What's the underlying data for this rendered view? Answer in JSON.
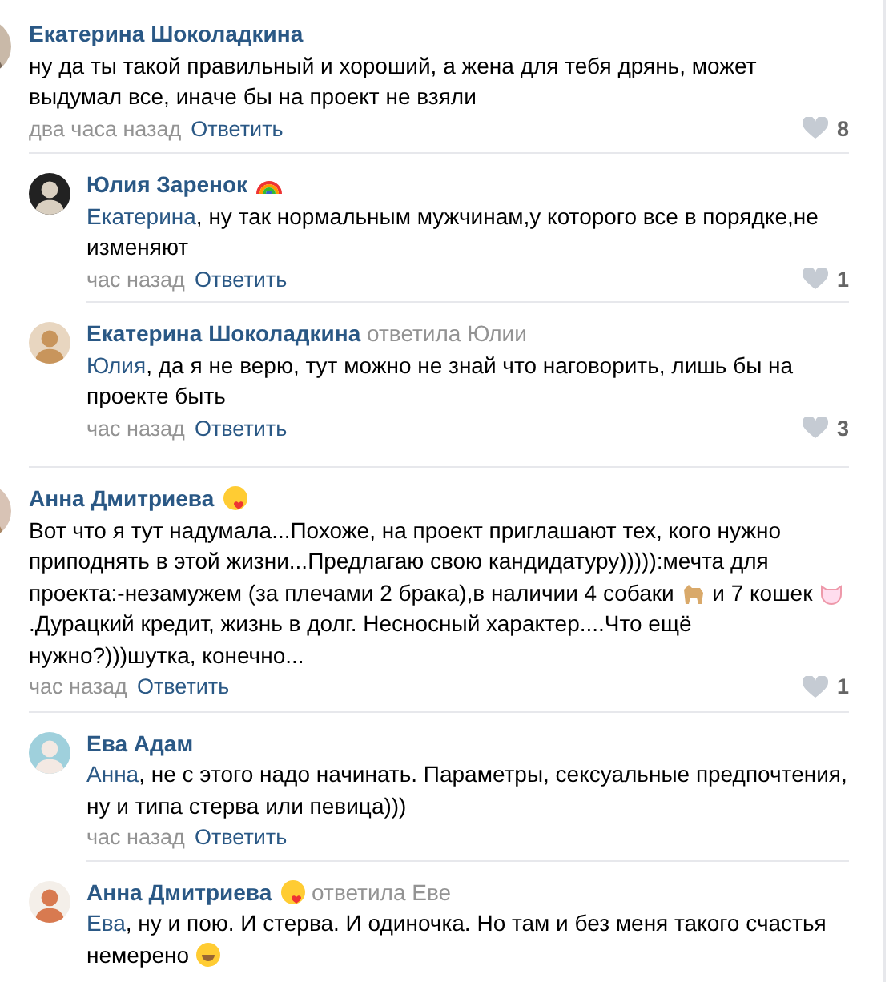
{
  "comments": [
    {
      "author": "Екатерина Шоколадкина",
      "avatar": {
        "kind": "picture"
      },
      "segments": [
        {
          "kind": "text",
          "text": "ну да ты такой правильный и хороший, а жена для тебя дрянь, может выдумал все, иначе бы на проект не взяли"
        }
      ],
      "time": "два часа назад",
      "reply_link": "Ответить",
      "likes": "8",
      "replies": [
        {
          "author": "Юлия Заренок",
          "name_emoji": {
            "kind": "rainbow"
          },
          "avatar": {
            "kind": "picture"
          },
          "segments": [
            {
              "kind": "mention",
              "text": "Екатерина"
            },
            {
              "kind": "text",
              "text": ", ну так нормальным мужчинам,у которого все в порядке,не изменяют"
            }
          ],
          "time": "час назад",
          "reply_link": "Ответить",
          "likes": "1"
        },
        {
          "author": "Екатерина Шоколадкина",
          "replied_to": "ответила Юлии",
          "avatar": {
            "kind": "picture"
          },
          "segments": [
            {
              "kind": "mention",
              "text": "Юлия"
            },
            {
              "kind": "text",
              "text": ", да я не верю, тут можно не знай что наговорить, лишь бы на проекте быть"
            }
          ],
          "time": "час назад",
          "reply_link": "Ответить",
          "likes": "3"
        }
      ]
    },
    {
      "author": "Анна Дмитриева",
      "name_emoji": {
        "kind": "kiss"
      },
      "avatar": {
        "kind": "picture"
      },
      "segments": [
        {
          "kind": "text",
          "text": "Вот что я тут надумала...Похоже, на проект приглашают тех, кого нужно приподнять в этой жизни...Предлагаю свою кандидатуру))))):мечта для проекта:-незамужем (за плечами 2 брака),в наличии 4 собаки "
        },
        {
          "kind": "dog"
        },
        {
          "kind": "text",
          "text": " и 7 кошек "
        },
        {
          "kind": "cat"
        },
        {
          "kind": "text",
          "text": " .Дурацкий кредит, жизнь в долг. Несносный характер....Что ещё нужно?)))шутка, конечно..."
        }
      ],
      "time": "час назад",
      "reply_link": "Ответить",
      "likes": "1",
      "replies": [
        {
          "author": "Ева Адам",
          "avatar": {
            "kind": "picture"
          },
          "segments": [
            {
              "kind": "mention",
              "text": "Анна"
            },
            {
              "kind": "text",
              "text": ", не с этого надо начинать. Параметры, сексуальные предпочтения, ну и типа стерва или певица)))"
            }
          ],
          "time": "час назад",
          "reply_link": "Ответить"
        },
        {
          "author": "Анна Дмитриева",
          "name_emoji": {
            "kind": "kiss"
          },
          "replied_to": "ответила Еве",
          "avatar": {
            "kind": "picture"
          },
          "segments": [
            {
              "kind": "mention",
              "text": "Ева"
            },
            {
              "kind": "text",
              "text": ", ну и пою. И стерва. И одиночка. Но там и без меня такого счастья немерено "
            },
            {
              "kind": "laugh"
            }
          ]
        }
      ]
    }
  ]
}
